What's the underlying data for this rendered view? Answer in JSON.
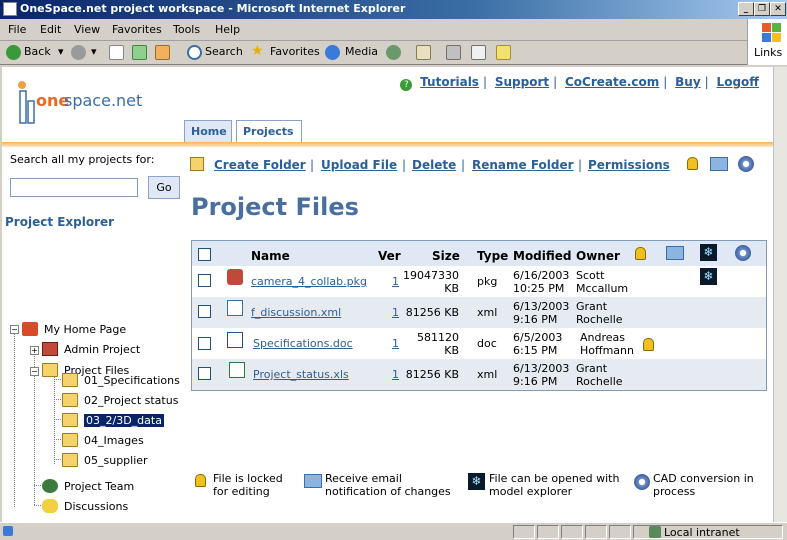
{
  "window": {
    "title": "OneSpace.net project workspace - Microsoft Internet Explorer"
  },
  "menu": [
    "File",
    "Edit",
    "View",
    "Favorites",
    "Tools",
    "Help"
  ],
  "toolbar": {
    "back": "Back",
    "search": "Search",
    "favorites": "Favorites",
    "media": "Media",
    "links": "Links"
  },
  "header": {
    "logo": {
      "brand": "one",
      "rest": "space.net"
    },
    "links": [
      "Tutorials",
      "Support",
      "CoCreate.com",
      "Buy",
      "Logoff"
    ],
    "tabs": [
      "Home",
      "Projects"
    ]
  },
  "sidebar": {
    "search_label": "Search all my projects for:",
    "search_value": "",
    "go_label": "Go",
    "explorer_title": "Project Explorer",
    "tree": [
      {
        "label": "My Home Page"
      },
      {
        "label": "Admin Project"
      },
      {
        "label": "Project Files"
      },
      {
        "label": "01_Specifications"
      },
      {
        "label": "02_Project status"
      },
      {
        "label": "03_2/3D_data"
      },
      {
        "label": "04_Images"
      },
      {
        "label": "05_supplier"
      },
      {
        "label": "Project Team"
      },
      {
        "label": "Discussions"
      }
    ]
  },
  "main": {
    "actions": [
      "Create Folder",
      "Upload File",
      "Delete",
      "Rename Folder",
      "Permissions"
    ],
    "title": "Project Files",
    "columns": [
      "Name",
      "Ver",
      "Size",
      "Type",
      "Modified",
      "Owner"
    ],
    "files": [
      {
        "name": "camera_4_collab.pkg",
        "ver": "1",
        "size1": "19047330",
        "size2": "KB",
        "type": "pkg",
        "date": "6/16/2003",
        "time": "10:25 PM",
        "owner1": "Scott",
        "owner2": "Mccallum"
      },
      {
        "name": "f_discussion.xml",
        "ver": "1",
        "size1": "81256 KB",
        "size2": "",
        "type": "xml",
        "date": "6/13/2003",
        "time": "9:16 PM",
        "owner1": "Grant",
        "owner2": "Rochelle"
      },
      {
        "name": "Specifications.doc",
        "ver": "1",
        "size1": "581120",
        "size2": "KB",
        "type": "doc",
        "date": "6/5/2003",
        "time": "6:15 PM",
        "owner1": "Andreas",
        "owner2": "Hoffmann"
      },
      {
        "name": "Project_status.xls",
        "ver": "1",
        "size1": "81256 KB",
        "size2": "",
        "type": "xml",
        "date": "6/13/2003",
        "time": "9:16 PM",
        "owner1": "Grant",
        "owner2": "Rochelle"
      }
    ]
  },
  "legend": [
    {
      "line1": "File is locked",
      "line2": "for editing"
    },
    {
      "line1": "Receive email",
      "line2": "notification of changes"
    },
    {
      "line1": "File can be opened with",
      "line2": "model explorer"
    },
    {
      "line1": "CAD conversion in",
      "line2": "process"
    }
  ],
  "status": {
    "zone": "Local intranet"
  },
  "colors": {
    "accent": "#2b5f96",
    "title": "#4a6f9e",
    "orange": "#f6b25a"
  }
}
